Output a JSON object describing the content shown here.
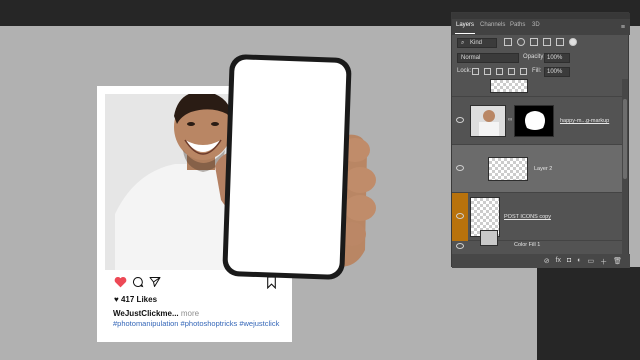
{
  "post": {
    "likes": "417 Likes",
    "username": "WeJustClickme...",
    "more": "more",
    "hashtags": "#photomanipulation #photoshoptricks #wejustclick"
  },
  "icons": [
    "heart-icon",
    "comment-icon",
    "share-icon",
    "bookmark-icon"
  ],
  "panel": {
    "tabs": [
      "Layers",
      "Channels",
      "Paths",
      "3D"
    ],
    "active_tab": "Layers",
    "menu_glyph": "≡",
    "kind_label": "Kind",
    "blend_mode": "Normal",
    "opacity_label": "Opacity:",
    "opacity_value": "100%",
    "lock_label": "Lock:",
    "fill_label": "Fill:",
    "fill_value": "100%",
    "layers": [
      {
        "name": "",
        "visible": false
      },
      {
        "name": "happy-m...g-markup",
        "visible": true
      },
      {
        "name": "Layer 2",
        "visible": true,
        "selected": true
      },
      {
        "name": "POST ICONS copy",
        "visible": true,
        "highlighted": true
      },
      {
        "name": "Color Fill 1",
        "visible": true
      }
    ],
    "bottom_icons": [
      "link-icon",
      "fx-icon",
      "mask-icon",
      "adjustment-icon",
      "folder-icon",
      "new-layer-icon",
      "trash-icon"
    ],
    "bottom_glyphs": [
      "⊘",
      "fx",
      "◘",
      "◐",
      "▭",
      "＋",
      "🗑"
    ]
  },
  "colors": {
    "canvas_bg": "#b1b1b1",
    "panel_bg": "#535353",
    "selected_row": "#6b6b6b",
    "highlight_orange": "#b8720c",
    "heart": "#ed4956",
    "hashtag": "#3567b8"
  }
}
